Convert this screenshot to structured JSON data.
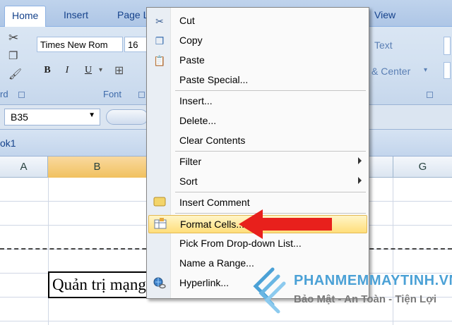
{
  "ribbon": {
    "tabs": [
      "Home",
      "Insert",
      "Page L",
      "View"
    ],
    "font_name": "Times New Rom",
    "font_size": "16",
    "bold_label": "B",
    "italic_label": "I",
    "underline_label": "U",
    "clipboard_group": "rd",
    "font_group": "Font",
    "wrap_text": "Text",
    "merge_center": "& Center"
  },
  "formula_bar": {
    "name_box": "B35"
  },
  "workbook": {
    "title": "ok1",
    "columns": [
      "A",
      "B",
      "G"
    ],
    "cell_text": "Quản trị mạng"
  },
  "context_menu": {
    "items": [
      {
        "label": "Cut",
        "icon": "scissors-icon"
      },
      {
        "label": "Copy",
        "icon": "copy-icon"
      },
      {
        "label": "Paste",
        "icon": "paste-icon"
      },
      {
        "label": "Paste Special...",
        "icon": ""
      },
      {
        "label": "Insert...",
        "icon": ""
      },
      {
        "label": "Delete...",
        "icon": ""
      },
      {
        "label": "Clear Contents",
        "icon": ""
      },
      {
        "label": "Filter",
        "icon": "",
        "submenu": true
      },
      {
        "label": "Sort",
        "icon": "",
        "submenu": true
      },
      {
        "label": "Insert Comment",
        "icon": "comment-icon"
      },
      {
        "label": "Format Cells...",
        "icon": "format-cells-icon",
        "highlighted": true
      },
      {
        "label": "Pick From Drop-down List...",
        "icon": ""
      },
      {
        "label": "Name a Range...",
        "icon": ""
      },
      {
        "label": "Hyperlink...",
        "icon": "hyperlink-icon"
      }
    ]
  },
  "watermark": {
    "brand": "PHANMEMMAYTINH.VN",
    "tagline": "Bảo Mật - An Toàn - Tiện Lợi"
  },
  "colors": {
    "highlight": "#ffde7a",
    "arrow": "#e8201c",
    "brand": "#4ba1d6"
  }
}
